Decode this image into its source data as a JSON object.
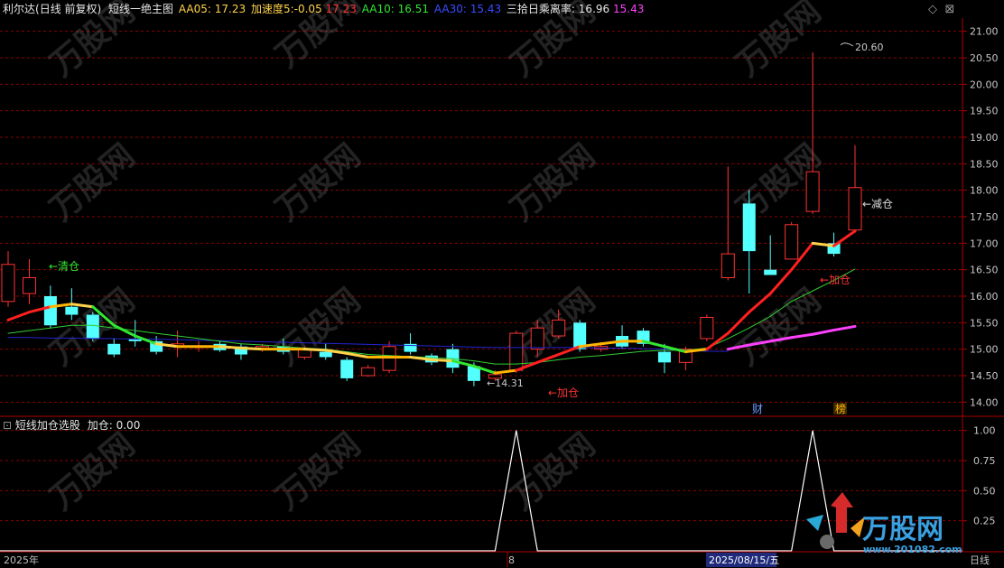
{
  "info_bar": {
    "stock_name": "利尔达",
    "period": "(日线 前复权)",
    "indicator_name": "短线一绝主图",
    "aa05_label": "AA05:",
    "aa05_value": "17.23",
    "accel_label": "加速度5:",
    "accel_value": "-0.05",
    "accel_extra": "17.23",
    "aa10_label": "AA10:",
    "aa10_value": "16.51",
    "aa30_label": "AA30:",
    "aa30_value": "15.43",
    "deviation_label": "三拾日乘离率:",
    "deviation_value": "16.96",
    "deviation_extra": "15.43"
  },
  "sub_bar": {
    "indicator_name": "短线加仓选股",
    "label": "加仓:",
    "value": "0.00"
  },
  "annotations": {
    "clear": "←清仓",
    "add1": "←加仓",
    "add2": "←加仓",
    "reduce": "←减仓",
    "low": "←14.31",
    "high": "20.60",
    "cai": "财",
    "bang": "榜"
  },
  "date_axis": {
    "year": "2025年",
    "month": "8",
    "cursor": "2025/08/15/五",
    "period": "日线"
  },
  "watermark": {
    "brand": "万股网",
    "url": "www.201082.com"
  },
  "colors": {
    "up": "#ff3232",
    "down": "#54ffff",
    "grid": "#8b0000",
    "aa30": "#ff40ff",
    "aa10": "#32cd32",
    "ma_dark": "#2424d0"
  },
  "chart_data": [
    {
      "type": "candlestick",
      "title": "短线一绝主图",
      "ylim": [
        13.75,
        21.25
      ],
      "y_ticks": [
        "14.00",
        "14.50",
        "15.00",
        "15.50",
        "16.00",
        "16.50",
        "17.00",
        "17.50",
        "18.00",
        "18.50",
        "19.00",
        "19.50",
        "20.00",
        "20.50",
        "21.00"
      ],
      "candles": [
        {
          "o": 15.9,
          "h": 16.85,
          "l": 15.8,
          "c": 16.6
        },
        {
          "o": 16.05,
          "h": 16.7,
          "l": 15.85,
          "c": 16.35
        },
        {
          "o": 16.0,
          "h": 16.2,
          "l": 15.4,
          "c": 15.45
        },
        {
          "o": 15.8,
          "h": 16.15,
          "l": 15.55,
          "c": 15.65
        },
        {
          "o": 15.65,
          "h": 15.7,
          "l": 15.15,
          "c": 15.2
        },
        {
          "o": 15.1,
          "h": 15.2,
          "l": 14.85,
          "c": 14.9
        },
        {
          "o": 15.2,
          "h": 15.55,
          "l": 15.05,
          "c": 15.15
        },
        {
          "o": 15.15,
          "h": 15.25,
          "l": 14.9,
          "c": 14.95
        },
        {
          "o": 15.05,
          "h": 15.35,
          "l": 14.85,
          "c": 15.1
        },
        {
          "o": 15.05,
          "h": 15.15,
          "l": 14.95,
          "c": 15.05
        },
        {
          "o": 15.1,
          "h": 15.15,
          "l": 14.95,
          "c": 14.98
        },
        {
          "o": 15.05,
          "h": 15.1,
          "l": 14.8,
          "c": 14.9
        },
        {
          "o": 15.0,
          "h": 15.1,
          "l": 14.95,
          "c": 15.05
        },
        {
          "o": 15.05,
          "h": 15.2,
          "l": 14.9,
          "c": 14.95
        },
        {
          "o": 14.85,
          "h": 15.05,
          "l": 14.8,
          "c": 15.0
        },
        {
          "o": 14.95,
          "h": 15.1,
          "l": 14.8,
          "c": 14.85
        },
        {
          "o": 14.8,
          "h": 14.85,
          "l": 14.4,
          "c": 14.45
        },
        {
          "o": 14.5,
          "h": 14.7,
          "l": 14.48,
          "c": 14.65
        },
        {
          "o": 14.6,
          "h": 15.15,
          "l": 14.55,
          "c": 15.05
        },
        {
          "o": 15.1,
          "h": 15.3,
          "l": 14.9,
          "c": 14.95
        },
        {
          "o": 14.88,
          "h": 14.92,
          "l": 14.7,
          "c": 14.75
        },
        {
          "o": 15.0,
          "h": 15.1,
          "l": 14.55,
          "c": 14.65
        },
        {
          "o": 14.68,
          "h": 14.75,
          "l": 14.3,
          "c": 14.4
        },
        {
          "o": 14.45,
          "h": 14.6,
          "l": 14.4,
          "c": 14.52
        },
        {
          "o": 14.6,
          "h": 15.35,
          "l": 14.55,
          "c": 15.3
        },
        {
          "o": 15.0,
          "h": 15.55,
          "l": 14.85,
          "c": 15.4
        },
        {
          "o": 15.25,
          "h": 15.75,
          "l": 15.2,
          "c": 15.55
        },
        {
          "o": 15.5,
          "h": 15.55,
          "l": 14.95,
          "c": 15.0
        },
        {
          "o": 15.0,
          "h": 15.1,
          "l": 14.95,
          "c": 15.05
        },
        {
          "o": 15.25,
          "h": 15.45,
          "l": 15.0,
          "c": 15.05
        },
        {
          "o": 15.35,
          "h": 15.4,
          "l": 15.05,
          "c": 15.1
        },
        {
          "o": 14.95,
          "h": 15.1,
          "l": 14.55,
          "c": 14.75
        },
        {
          "o": 14.75,
          "h": 15.05,
          "l": 14.6,
          "c": 15.0
        },
        {
          "o": 15.2,
          "h": 15.65,
          "l": 15.15,
          "c": 15.6
        },
        {
          "o": 16.35,
          "h": 18.45,
          "l": 16.3,
          "c": 16.8
        },
        {
          "o": 17.75,
          "h": 18.0,
          "l": 16.05,
          "c": 16.85
        },
        {
          "o": 16.5,
          "h": 17.15,
          "l": 16.4,
          "c": 16.4
        },
        {
          "o": 16.7,
          "h": 17.4,
          "l": 16.7,
          "c": 17.35
        },
        {
          "o": 17.6,
          "h": 20.6,
          "l": 17.55,
          "c": 18.35
        },
        {
          "o": 17.0,
          "h": 17.2,
          "l": 16.75,
          "c": 16.8
        },
        {
          "o": 17.25,
          "h": 18.85,
          "l": 17.2,
          "c": 18.05
        }
      ],
      "series": [
        {
          "name": "AA05",
          "values": [
            15.55,
            15.7,
            15.8,
            15.85,
            15.8,
            15.45,
            15.25,
            15.1,
            15.05,
            15.05,
            15.05,
            15.02,
            15.0,
            15.0,
            15.0,
            14.98,
            14.92,
            14.85,
            14.85,
            14.85,
            14.8,
            14.78,
            14.68,
            14.55,
            14.6,
            14.75,
            14.9,
            15.05,
            15.1,
            15.15,
            15.15,
            15.05,
            14.95,
            15.0,
            15.3,
            15.7,
            16.05,
            16.5,
            17.0,
            16.95,
            17.23
          ]
        },
        {
          "name": "AA10",
          "values": [
            15.3,
            15.35,
            15.4,
            15.45,
            15.45,
            15.4,
            15.35,
            15.3,
            15.25,
            15.2,
            15.15,
            15.1,
            15.08,
            15.05,
            15.02,
            15.0,
            14.95,
            14.9,
            14.88,
            14.86,
            14.84,
            14.82,
            14.78,
            14.72,
            14.72,
            14.75,
            14.8,
            14.85,
            14.88,
            14.92,
            14.96,
            14.98,
            14.98,
            15.02,
            15.2,
            15.4,
            15.62,
            15.9,
            16.1,
            16.3,
            16.51
          ]
        },
        {
          "name": "AA30",
          "values": [
            null,
            null,
            null,
            null,
            null,
            null,
            null,
            null,
            null,
            null,
            null,
            null,
            null,
            null,
            null,
            null,
            null,
            null,
            null,
            null,
            null,
            null,
            null,
            null,
            null,
            null,
            null,
            null,
            null,
            null,
            null,
            null,
            null,
            null,
            15.0,
            15.08,
            15.15,
            15.22,
            15.28,
            15.36,
            15.43
          ]
        },
        {
          "name": "MA_dark",
          "values": [
            15.22,
            15.22,
            15.21,
            15.21,
            15.2,
            15.2,
            15.19,
            15.19,
            15.18,
            15.17,
            15.16,
            15.15,
            15.14,
            15.13,
            15.12,
            15.11,
            15.1,
            15.09,
            15.08,
            15.07,
            15.06,
            15.05,
            15.04,
            15.03,
            15.03,
            15.03,
            15.03,
            15.03,
            15.02,
            15.02,
            15.01,
            15.0,
            14.98,
            14.96,
            14.96,
            null,
            null,
            null,
            null,
            null,
            null
          ]
        }
      ]
    },
    {
      "type": "line",
      "title": "短线加仓选股",
      "ylim": [
        0,
        1.05
      ],
      "y_ticks": [
        "0.25",
        "0.50",
        "0.75",
        "1.00"
      ],
      "series": [
        {
          "name": "加仓",
          "values": [
            0,
            0,
            0,
            0,
            0,
            0,
            0,
            0,
            0,
            0,
            0,
            0,
            0,
            0,
            0,
            0,
            0,
            0,
            0,
            0,
            0,
            0,
            0,
            0,
            1,
            0,
            0,
            0,
            0,
            0,
            0,
            0,
            0,
            0,
            0,
            0,
            0,
            0,
            1,
            0,
            0
          ]
        }
      ]
    }
  ]
}
